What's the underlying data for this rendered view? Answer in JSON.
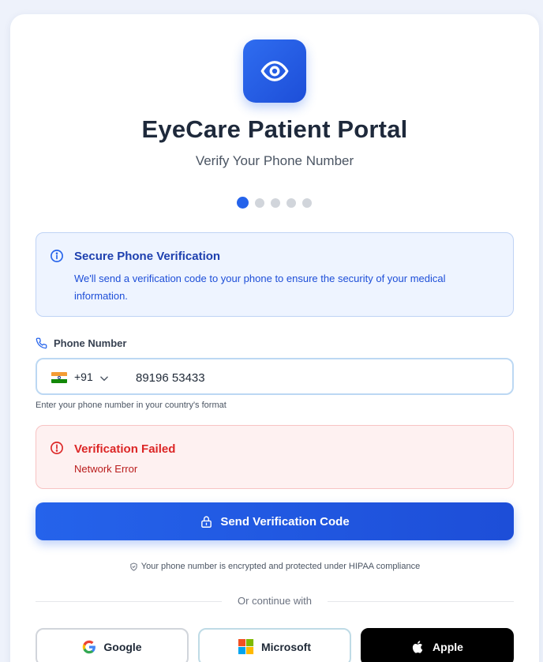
{
  "app": {
    "title": "EyeCare Patient Portal",
    "subtitle": "Verify Your Phone Number",
    "logo_icon": "eye-icon",
    "accent": "#2563eb"
  },
  "progress": {
    "total_steps": 5,
    "current_step": 1
  },
  "info": {
    "icon": "info-icon",
    "title": "Secure Phone Verification",
    "text": "We'll send a verification code to your phone to ensure the security of your medical information."
  },
  "phone": {
    "label": "Phone Number",
    "label_icon": "phone-icon",
    "country_flag": "india-flag",
    "country_code": "+91",
    "value": "89196 53433",
    "helper": "Enter your phone number in your country's format"
  },
  "error": {
    "icon": "alert-circle-icon",
    "title": "Verification Failed",
    "message": "Network Error",
    "color": "#dc2626"
  },
  "send_button": {
    "icon": "lock-icon",
    "label": "Send Verification Code"
  },
  "security_note": {
    "icon": "shield-icon",
    "text": "Your phone number is encrypted and protected under HIPAA compliance"
  },
  "divider": {
    "text": "Or continue with"
  },
  "social": [
    {
      "label": "Google",
      "icon": "google-icon"
    },
    {
      "label": "Microsoft",
      "icon": "microsoft-icon"
    },
    {
      "label": "Apple",
      "icon": "apple-icon"
    }
  ]
}
